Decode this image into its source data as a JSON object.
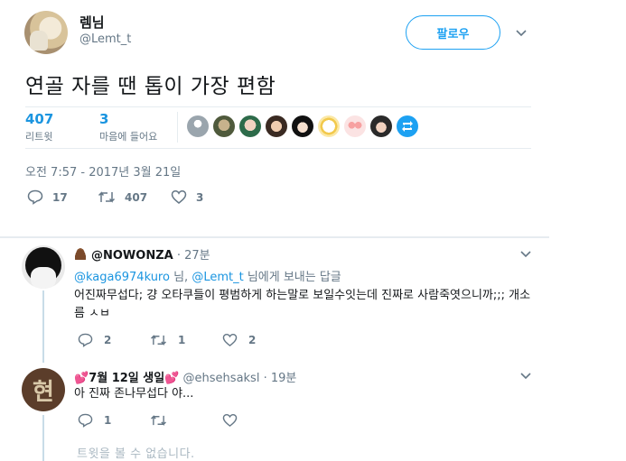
{
  "tweet": {
    "display_name": "렘님",
    "handle": "@Lemt_t",
    "follow_label": "팔로우",
    "text": "연골 자를 땐 톱이 가장 편함",
    "retweets": {
      "count": "407",
      "label": "리트윗"
    },
    "likes": {
      "count": "3",
      "label": "마음에 들어요"
    },
    "timestamp": "오전 7:57 - 2017년 3월 21일",
    "actions": {
      "reply_count": "17",
      "retweet_count": "407",
      "like_count": "3"
    }
  },
  "replies": [
    {
      "display_name": "@NOWONZA",
      "time": "· 27분",
      "replying_prefix": "",
      "replying_user1": "@kaga6974kuro",
      "replying_mid": " 님, ",
      "replying_user2": "@Lemt_t",
      "replying_suffix": " 님에게 보내는 답글",
      "text": "어진짜무섭다; 걍 오타쿠들이 평범하게 하는말로 보일수잇는데 진짜로 사람죽엿으니까;;; 개소름 ㅅㅂ",
      "reply_count": "2",
      "retweet_count": "1",
      "like_count": "2"
    },
    {
      "display_name": "7월 12일 생일",
      "handle": "@ehsehsaksl",
      "time": "· 19분",
      "avatar_char": "현",
      "text": "아 진짜 존나무섭다 야...",
      "reply_count": "1",
      "retweet_count": "",
      "like_count": ""
    }
  ],
  "unavailable_text": "트윗을 볼 수 없습니다.",
  "colors": {
    "accent": "#1da1f2",
    "link": "#1b95e0",
    "muted": "#657786",
    "like": "#e0245e"
  }
}
